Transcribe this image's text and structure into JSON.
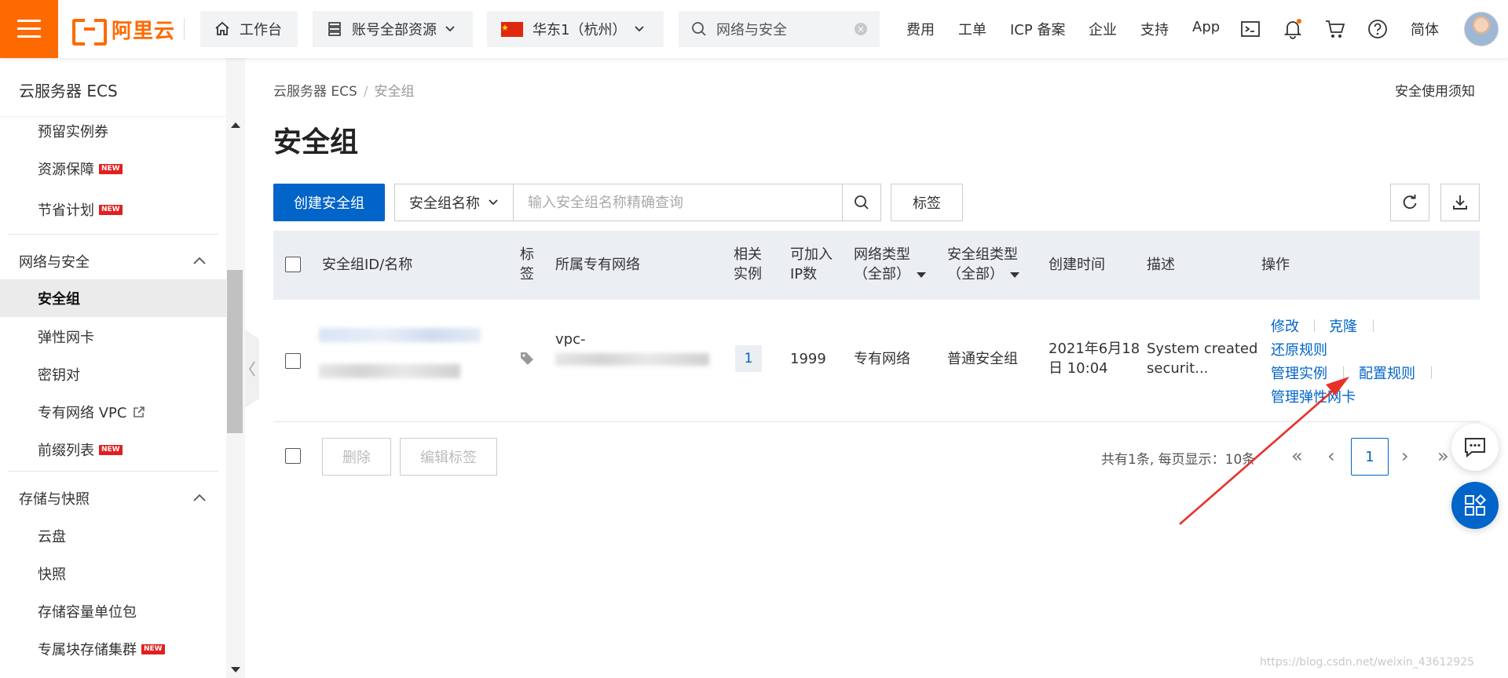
{
  "header": {
    "brand": "阿里云",
    "workbench": "工作台",
    "resource_scope": "账号全部资源",
    "region": "华东1（杭州）",
    "search_value": "网络与安全",
    "links": [
      "费用",
      "工单",
      "ICP 备案",
      "企业",
      "支持",
      "App"
    ],
    "lang": "简体"
  },
  "sidebar": {
    "title": "云服务器 ECS",
    "top_items": [
      {
        "label": "预留实例券",
        "badge": ""
      },
      {
        "label": "资源保障",
        "badge": "NEW"
      },
      {
        "label": "节省计划",
        "badge": "NEW"
      }
    ],
    "group_network": "网络与安全",
    "network_items": [
      {
        "label": "安全组",
        "active": true
      },
      {
        "label": "弹性网卡"
      },
      {
        "label": "密钥对"
      },
      {
        "label": "专有网络 VPC",
        "external": true
      },
      {
        "label": "前缀列表",
        "badge": "NEW"
      }
    ],
    "group_storage": "存储与快照",
    "storage_items": [
      {
        "label": "云盘"
      },
      {
        "label": "快照"
      },
      {
        "label": "存储容量单位包"
      },
      {
        "label": "专属块存储集群",
        "badge": "NEW"
      }
    ]
  },
  "breadcrumb": {
    "root": "云服务器 ECS",
    "sep": "/",
    "current": "安全组"
  },
  "notice_link": "安全使用须知",
  "page_title": "安全组",
  "toolbar": {
    "create_label": "创建安全组",
    "filter_field": "安全组名称",
    "filter_placeholder": "输入安全组名称精确查询",
    "tag_label": "标签"
  },
  "table": {
    "headers": {
      "id_name": "安全组ID/名称",
      "tag_1": "标",
      "tag_2": "签",
      "vpc": "所属专有网络",
      "related_1": "相关",
      "related_2": "实例",
      "ip_1": "可加入",
      "ip_2": "IP数",
      "net_type_1": "网络类型",
      "net_type_2": "（全部）",
      "sg_type_1": "安全组类型",
      "sg_type_2": "（全部）",
      "created": "创建时间",
      "desc": "描述",
      "ops": "操作"
    },
    "rows": [
      {
        "vpc_prefix": "vpc-",
        "related": "1",
        "ip_count": "1999",
        "net_type": "专有网络",
        "sg_type": "普通安全组",
        "created_1": "2021年6月18",
        "created_2": "日 10:04",
        "desc_1": "System created",
        "desc_2": "securit...",
        "ops": {
          "modify": "修改",
          "clone": "克隆",
          "restore": "还原规则",
          "manage_instances": "管理实例",
          "config_rules": "配置规则",
          "manage_eni": "管理弹性网卡"
        }
      }
    ]
  },
  "footer": {
    "delete_label": "删除",
    "edit_tags_label": "编辑标签",
    "pager_text": "共有1条, 每页显示：10条",
    "first": "«",
    "prev": "‹",
    "current_page": "1",
    "next": "›",
    "last": "»"
  },
  "watermark": "https://blog.csdn.net/weixin_43612925",
  "colors": {
    "brand": "#ff6a00",
    "primary": "#0064c8",
    "annotation_arrow": "#e8302a"
  }
}
